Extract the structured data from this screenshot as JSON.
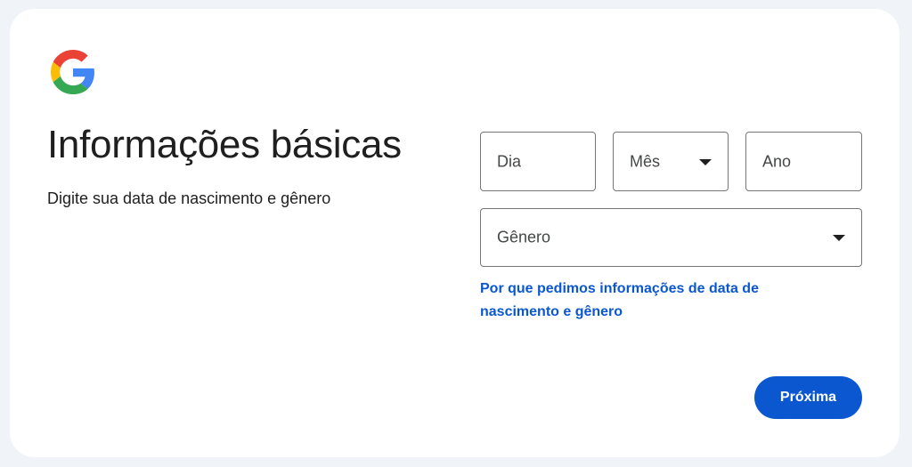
{
  "header": {
    "logo_icon": "google-g-icon",
    "title": "Informações básicas",
    "subtitle": "Digite sua data de nascimento e gênero"
  },
  "form": {
    "day": {
      "placeholder": "Dia",
      "value": ""
    },
    "month": {
      "placeholder": "Mês",
      "value": "",
      "icon": "dropdown-arrow-icon"
    },
    "year": {
      "placeholder": "Ano",
      "value": ""
    },
    "gender": {
      "placeholder": "Gênero",
      "value": "",
      "icon": "dropdown-arrow-icon"
    },
    "why_link": "Por que pedimos informações de data de nascimento e gênero"
  },
  "actions": {
    "next_label": "Próxima"
  },
  "colors": {
    "page_bg": "#f0f4f9",
    "card_bg": "#ffffff",
    "primary": "#0b57d0",
    "text": "#1f1f1f",
    "border": "#747775"
  }
}
